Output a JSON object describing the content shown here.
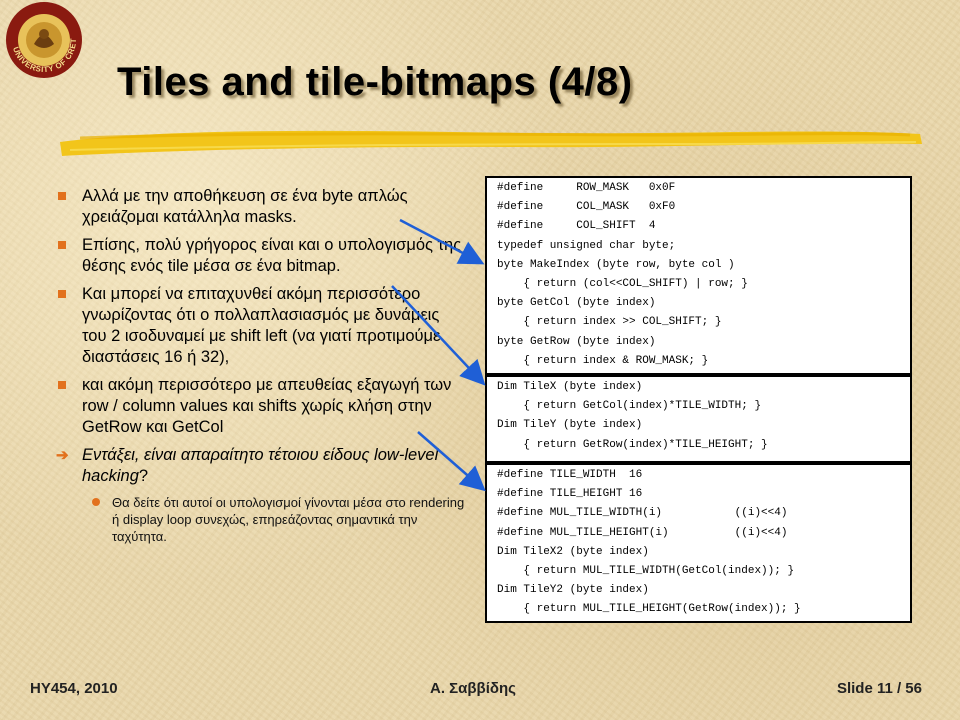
{
  "slide": {
    "title": "Tiles and tile-bitmaps (4/8)",
    "logo_text": "UNIVERSITY OF CRETE"
  },
  "bullets": [
    {
      "text": "Αλλά με την αποθήκευση σε ένα byte απλώς χρειάζομαι κατάλληλα masks."
    },
    {
      "text": "Επίσης, πολύ γρήγορος είναι και ο υπολογισμός της θέσης ενός tile μέσα σε ένα bitmap."
    },
    {
      "text": "Και μπορεί να επιταχυνθεί ακόμη περισσότερο γνωρίζοντας ότι ο πολλαπλασιασμός με δυνάμεις του 2 ισοδυναμεί με shift left (να γιατί προτιμούμε διαστάσεις 16 ή 32),"
    },
    {
      "text": "και ακόμη περισσότερο με απευθείας εξαγωγή των row / column values και shifts χωρίς κλήση στην GetRow και GetCol"
    },
    {
      "italic": "Εντάξει, είναι απαραίτητο τέτοιου είδους low-level hacking",
      "suffix": "?"
    }
  ],
  "subbullet": "Θα δείτε ότι αυτοί οι υπολογισμοί γίνονται μέσα στο rendering ή display loop συνεχώς, επηρεάζοντας σημαντικά την ταχύτητα.",
  "code_blocks": [
    {
      "lines": [
        "#define     ROW_MASK   0x0F",
        "#define     COL_MASK   0xF0",
        "#define     COL_SHIFT  4",
        "typedef unsigned char byte;",
        "byte MakeIndex (byte row, byte col )",
        "    { return (col<<COL_SHIFT) | row; }",
        "byte GetCol (byte index)",
        "    { return index >> COL_SHIFT; }",
        "byte GetRow (byte index)",
        "    { return index & ROW_MASK; }"
      ]
    },
    {
      "lines": [
        "Dim TileX (byte index)",
        "    { return GetCol(index)*TILE_WIDTH; }",
        "Dim TileY (byte index)",
        "    { return GetRow(index)*TILE_HEIGHT; }"
      ]
    },
    {
      "lines": [
        "#define TILE_WIDTH  16",
        "#define TILE_HEIGHT 16",
        "#define MUL_TILE_WIDTH(i)           ((i)<<4)",
        "#define MUL_TILE_HEIGHT(i)          ((i)<<4)",
        "Dim TileX2 (byte index)",
        "    { return MUL_TILE_WIDTH(GetCol(index)); }",
        "Dim TileY2 (byte index)",
        "    { return MUL_TILE_HEIGHT(GetRow(index)); }"
      ]
    }
  ],
  "footer": {
    "course": "HY454, 2010",
    "author": "Α. Σαββίδης",
    "slide_number": "Slide 11 / 56"
  },
  "colors": {
    "bullet": "#e2711d",
    "arrow": "#1f5fd6",
    "brush": "#f2c51a"
  }
}
